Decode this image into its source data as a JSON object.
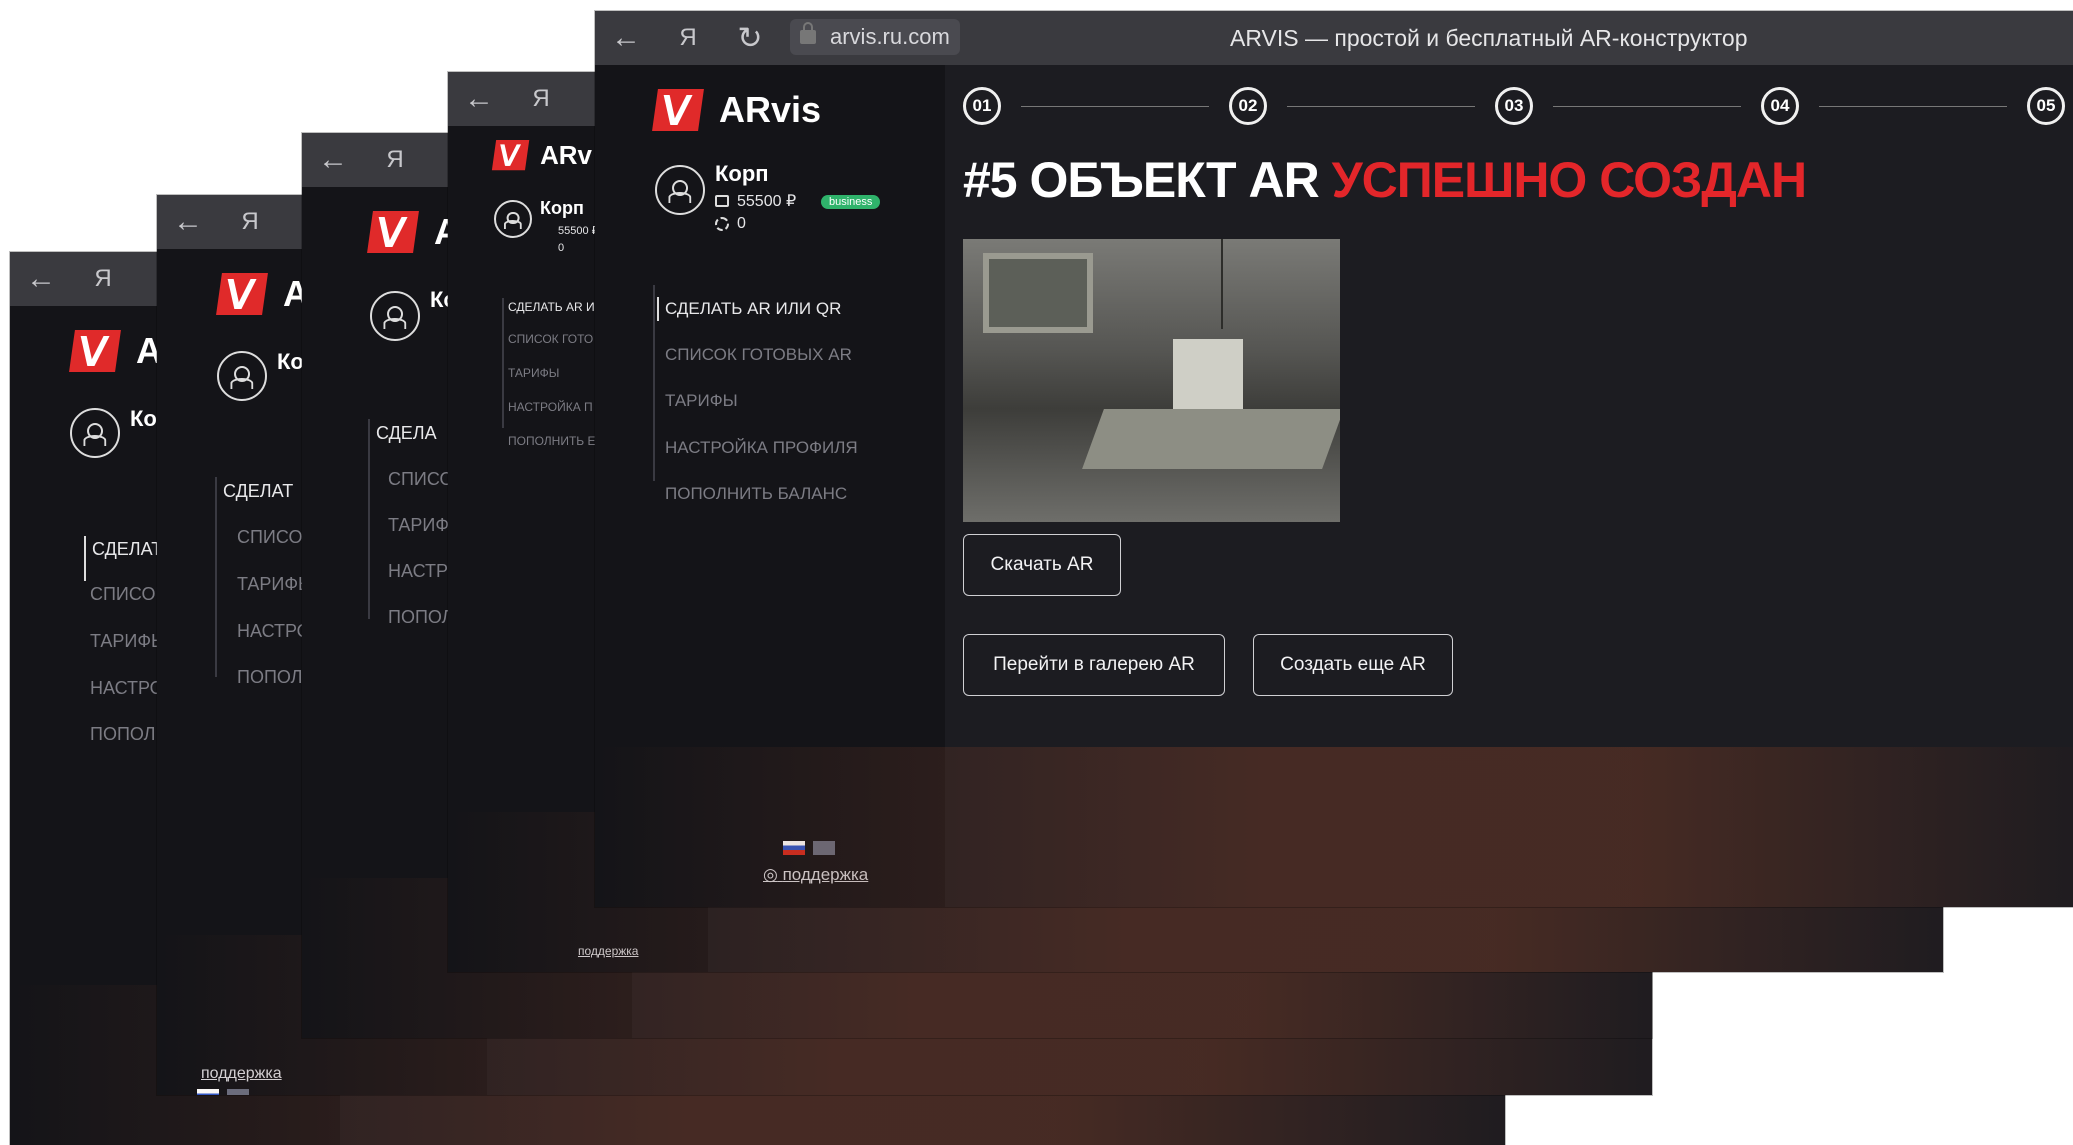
{
  "browser": {
    "back_icon": "arrow-left-icon",
    "yandex_label": "Я",
    "reload_icon": "reload-icon",
    "url": "arvis.ru.com",
    "title": "ARVIS — простой и бесплатный AR-конструктор"
  },
  "brand": {
    "name": "ARvis",
    "short1": "ARv",
    "short2": "A"
  },
  "user": {
    "name": "Корп",
    "name_short": "Ко",
    "balance": "55500 ₽",
    "balance_short": "55500 ₽",
    "plan_badge": "business",
    "ar_count": "0"
  },
  "menu": {
    "items": [
      {
        "label": "СДЕЛАТЬ AR ИЛИ QR",
        "active": true
      },
      {
        "label": "СПИСОК ГОТОВЫХ AR",
        "active": false
      },
      {
        "label": "ТАРИФЫ",
        "active": false
      },
      {
        "label": "НАСТРОЙКА ПРОФИЛЯ",
        "active": false
      },
      {
        "label": "ПОПОЛНИТЬ БАЛАНС",
        "active": false
      }
    ],
    "w3": [
      "СДЕЛАТЬ AR И",
      "СПИСОК ГОТО",
      "ТАРИФЫ",
      "НАСТРОЙКА П",
      "ПОПОЛНИТЬ Е"
    ],
    "w2": [
      "СДЕЛА",
      "СПИСО",
      "ТАРИФ",
      "НАСТР",
      "ПОПОЛ"
    ],
    "w1": [
      "СДЕЛАТ",
      "СПИСОК",
      "ТАРИФЬ",
      "НАСТРО",
      "ПОПОЛІ"
    ],
    "w0": [
      "СДЕЛАТІ",
      "СПИСОК",
      "ТАРИФЬ",
      "НАСТРО",
      "ПОПОЛІ"
    ]
  },
  "support": {
    "label": "поддержка"
  },
  "steps": [
    "01",
    "02",
    "03",
    "04",
    "05"
  ],
  "result": {
    "headline_white": "#5 ОБЪЕКТ AR ",
    "headline_red": "УСПЕШНО СОЗДАН",
    "download_label": "Скачать AR",
    "gallery_label": "Перейти в галерею AR",
    "create_more_label": "Создать еще AR"
  },
  "colors": {
    "accent": "#e3262a",
    "badge": "#2fb36b",
    "bg": "#1c1c21",
    "sidebar": "#141418"
  }
}
